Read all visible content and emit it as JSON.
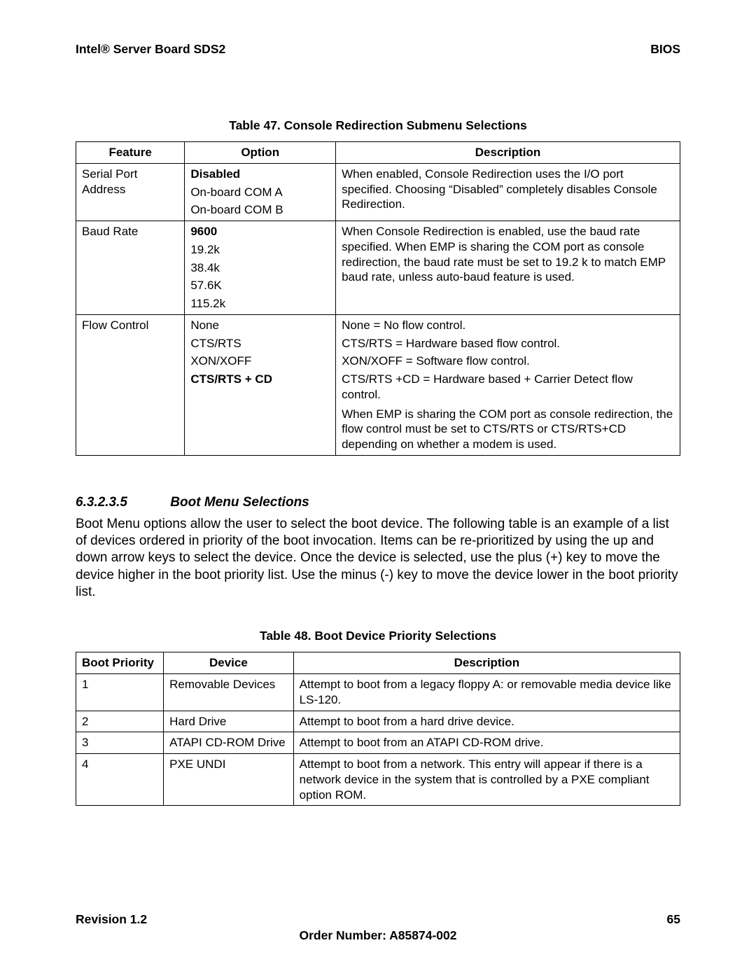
{
  "header": {
    "left": "Intel® Server Board SDS2",
    "right": "BIOS"
  },
  "table47": {
    "caption": "Table 47. Console Redirection Submenu Selections",
    "headers": [
      "Feature",
      "Option",
      "Description"
    ],
    "rows": [
      {
        "feature": "Serial Port Address",
        "options": [
          {
            "text": "Disabled",
            "bold": true
          },
          {
            "text": "On-board COM A",
            "bold": false
          },
          {
            "text": "On-board COM B",
            "bold": false
          }
        ],
        "description_lines": [
          "When enabled, Console Redirection uses the I/O port specified. Choosing “Disabled” completely disables Console Redirection."
        ]
      },
      {
        "feature": "Baud Rate",
        "options": [
          {
            "text": "9600",
            "bold": true
          },
          {
            "text": "19.2k",
            "bold": false
          },
          {
            "text": "38.4k",
            "bold": false
          },
          {
            "text": "57.6K",
            "bold": false
          },
          {
            "text": "115.2k",
            "bold": false
          }
        ],
        "description_lines": [
          "When Console Redirection is enabled, use the baud rate specified.  When EMP is sharing the COM port as console redirection, the baud rate must be set to 19.2 k to match EMP baud rate, unless auto-baud feature is used."
        ]
      },
      {
        "feature": "Flow Control",
        "options": [
          {
            "text": "None",
            "bold": false
          },
          {
            "text": "CTS/RTS",
            "bold": false
          },
          {
            "text": "XON/XOFF",
            "bold": false
          },
          {
            "text": "CTS/RTS + CD",
            "bold": true
          }
        ],
        "description_lines": [
          "None = No flow control.",
          "CTS/RTS = Hardware based flow control.",
          "XON/XOFF = Software flow control.",
          "CTS/RTS +CD = Hardware based + Carrier Detect flow control."
        ],
        "description_block": "When EMP is sharing the COM port as console redirection, the flow control must be set to CTS/RTS or CTS/RTS+CD depending on whether a modem is used."
      }
    ]
  },
  "section": {
    "number": "6.3.2.3.5",
    "title": "Boot Menu Selections",
    "body": "Boot Menu options allow the user to select the boot device. The following table is an example of a list of devices ordered in priority of the boot invocation. Items can be re-prioritized by using the up and down arrow keys to select the device. Once the device is selected, use the plus (+) key to move the device higher in the boot priority list. Use the minus (-) key to move the device lower in the boot priority list."
  },
  "table48": {
    "caption": "Table 48. Boot Device Priority Selections",
    "headers": [
      "Boot Priority",
      "Device",
      "Description"
    ],
    "rows": [
      {
        "priority": "1",
        "device": "Removable Devices",
        "description": "Attempt to boot from a legacy floppy A: or removable media device like LS-120."
      },
      {
        "priority": "2",
        "device": "Hard Drive",
        "description": "Attempt to boot from a hard drive device."
      },
      {
        "priority": "3",
        "device": "ATAPI CD-ROM Drive",
        "description": "Attempt to boot from an ATAPI CD-ROM drive."
      },
      {
        "priority": "4",
        "device": "PXE UNDI",
        "description": "Attempt to boot from a network. This entry will appear if there is a network device in the system that is controlled by a PXE compliant option ROM."
      }
    ]
  },
  "footer": {
    "revision": "Revision 1.2",
    "page": "65",
    "order": "Order Number:  A85874-002"
  }
}
